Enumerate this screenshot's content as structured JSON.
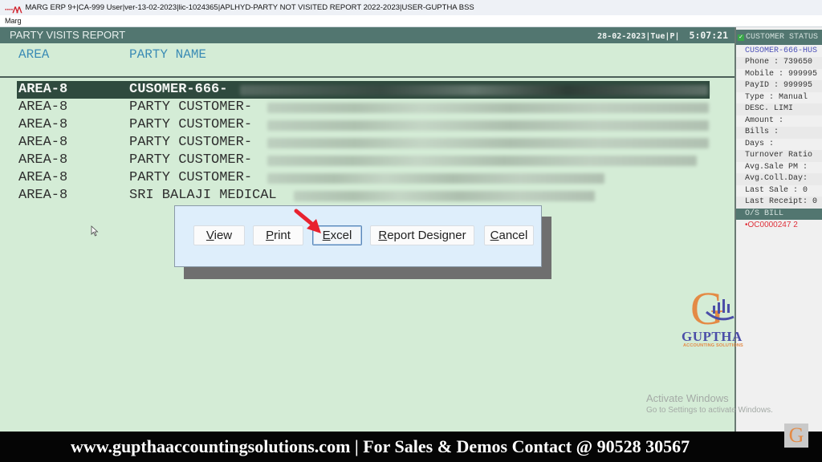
{
  "window": {
    "title": "MARG ERP 9+|CA-999 User|ver-13-02-2023|lic-1024365|APLHYD-PARTY NOT VISITED REPORT 2022-2023|USER-GUPTHA BSS",
    "logo_icon": "marg-logo-icon",
    "menu_label": "Marg"
  },
  "report": {
    "title": "PARTY VISITS REPORT",
    "date": "28-02-2023|Tue|P|",
    "time": "5:07:21",
    "columns": {
      "area": "AREA",
      "party_name": "PARTY NAME"
    },
    "rows": [
      {
        "area": "AREA-8",
        "party": "CUSOMER-666-",
        "selected": true
      },
      {
        "area": "AREA-8",
        "party": "PARTY CUSTOMER-"
      },
      {
        "area": "AREA-8",
        "party": "PARTY CUSTOMER-"
      },
      {
        "area": "AREA-8",
        "party": "PARTY CUSTOMER-"
      },
      {
        "area": "AREA-8",
        "party": "PARTY CUSTOMER-"
      },
      {
        "area": "AREA-8",
        "party": "PARTY CUSTOMER-"
      },
      {
        "area": "AREA-8",
        "party": "SRI BALAJI MEDICAL"
      }
    ]
  },
  "dialog": {
    "buttons": [
      {
        "label": "View",
        "mnemonic": "V"
      },
      {
        "label": "Print",
        "mnemonic": "P"
      },
      {
        "label": "Excel",
        "mnemonic": "E",
        "focused": true
      },
      {
        "label": "Report Designer",
        "mnemonic": "R"
      },
      {
        "label": "Cancel",
        "mnemonic": "C"
      }
    ],
    "annotation_color": "#e8222f"
  },
  "customer_status": {
    "header": "CUSTOMER STATUS",
    "name": "CUSOMER-666-HUS",
    "fields": [
      "Phone  : 739650",
      "Mobile : 999995",
      "PayID  : 999995",
      "Type   : Manual",
      "DESC.     LIMI",
      "Amount :",
      "Bills  :",
      "Days   :",
      "Turnover Ratio",
      "Avg.Sale PM :",
      "Avg.Coll.Day:",
      "Last Sale   : 0",
      "Last Receipt: 0"
    ],
    "os_bill_header": "O/S BILL",
    "os_bill_row": "•OC0000247     2"
  },
  "branding": {
    "logo_letter": "G",
    "logo_word": "GUPTHA",
    "logo_tagline": "ACCOUNTING SOLUTIONS",
    "footer_text": "www.gupthaaccountingsolutions.com | For Sales & Demos Contact @ 90528 30567"
  },
  "watermark": {
    "line1": "Activate Windows",
    "line2": "Go to Settings to activate Windows."
  },
  "colors": {
    "header_bg": "#527670",
    "report_bg": "#d4ecd6",
    "selected_row_bg": "#2f4a3e",
    "column_header_text": "#3c8cb5",
    "customer_name_text": "#4b4fb8",
    "os_bill_text": "#e0303a"
  }
}
